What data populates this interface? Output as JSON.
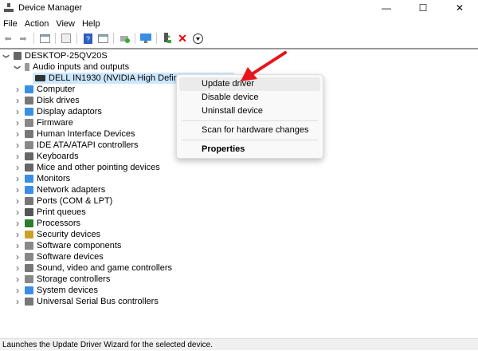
{
  "window": {
    "title": "Device Manager",
    "minimize": "—",
    "maximize": "☐",
    "close": "✕"
  },
  "menu": [
    "File",
    "Action",
    "View",
    "Help"
  ],
  "tree": {
    "root": "DESKTOP-25QV20S",
    "audio": "Audio inputs and outputs",
    "selected_device": "DELL IN1930 (NVIDIA High Definition A",
    "categories": [
      {
        "label": "Computer",
        "color": "#3a8ee6"
      },
      {
        "label": "Disk drives",
        "color": "#777"
      },
      {
        "label": "Display adaptors",
        "color": "#3a8ee6"
      },
      {
        "label": "Firmware",
        "color": "#888"
      },
      {
        "label": "Human Interface Devices",
        "color": "#777"
      },
      {
        "label": "IDE ATA/ATAPI controllers",
        "color": "#888"
      },
      {
        "label": "Keyboards",
        "color": "#666"
      },
      {
        "label": "Mice and other pointing devices",
        "color": "#666"
      },
      {
        "label": "Monitors",
        "color": "#3a8ee6"
      },
      {
        "label": "Network adapters",
        "color": "#3a8ee6"
      },
      {
        "label": "Ports (COM & LPT)",
        "color": "#777"
      },
      {
        "label": "Print queues",
        "color": "#555"
      },
      {
        "label": "Processors",
        "color": "#2d7d2d"
      },
      {
        "label": "Security devices",
        "color": "#c9a227"
      },
      {
        "label": "Software components",
        "color": "#888"
      },
      {
        "label": "Software devices",
        "color": "#888"
      },
      {
        "label": "Sound, video and game controllers",
        "color": "#777"
      },
      {
        "label": "Storage controllers",
        "color": "#888"
      },
      {
        "label": "System devices",
        "color": "#3a8ee6"
      },
      {
        "label": "Universal Serial Bus controllers",
        "color": "#777"
      }
    ]
  },
  "context_menu": {
    "update": "Update driver",
    "disable": "Disable device",
    "uninstall": "Uninstall device",
    "scan": "Scan for hardware changes",
    "properties": "Properties"
  },
  "status": "Launches the Update Driver Wizard for the selected device.",
  "colors": {
    "arrow": "#e8141c",
    "selection": "#cce8ff"
  }
}
